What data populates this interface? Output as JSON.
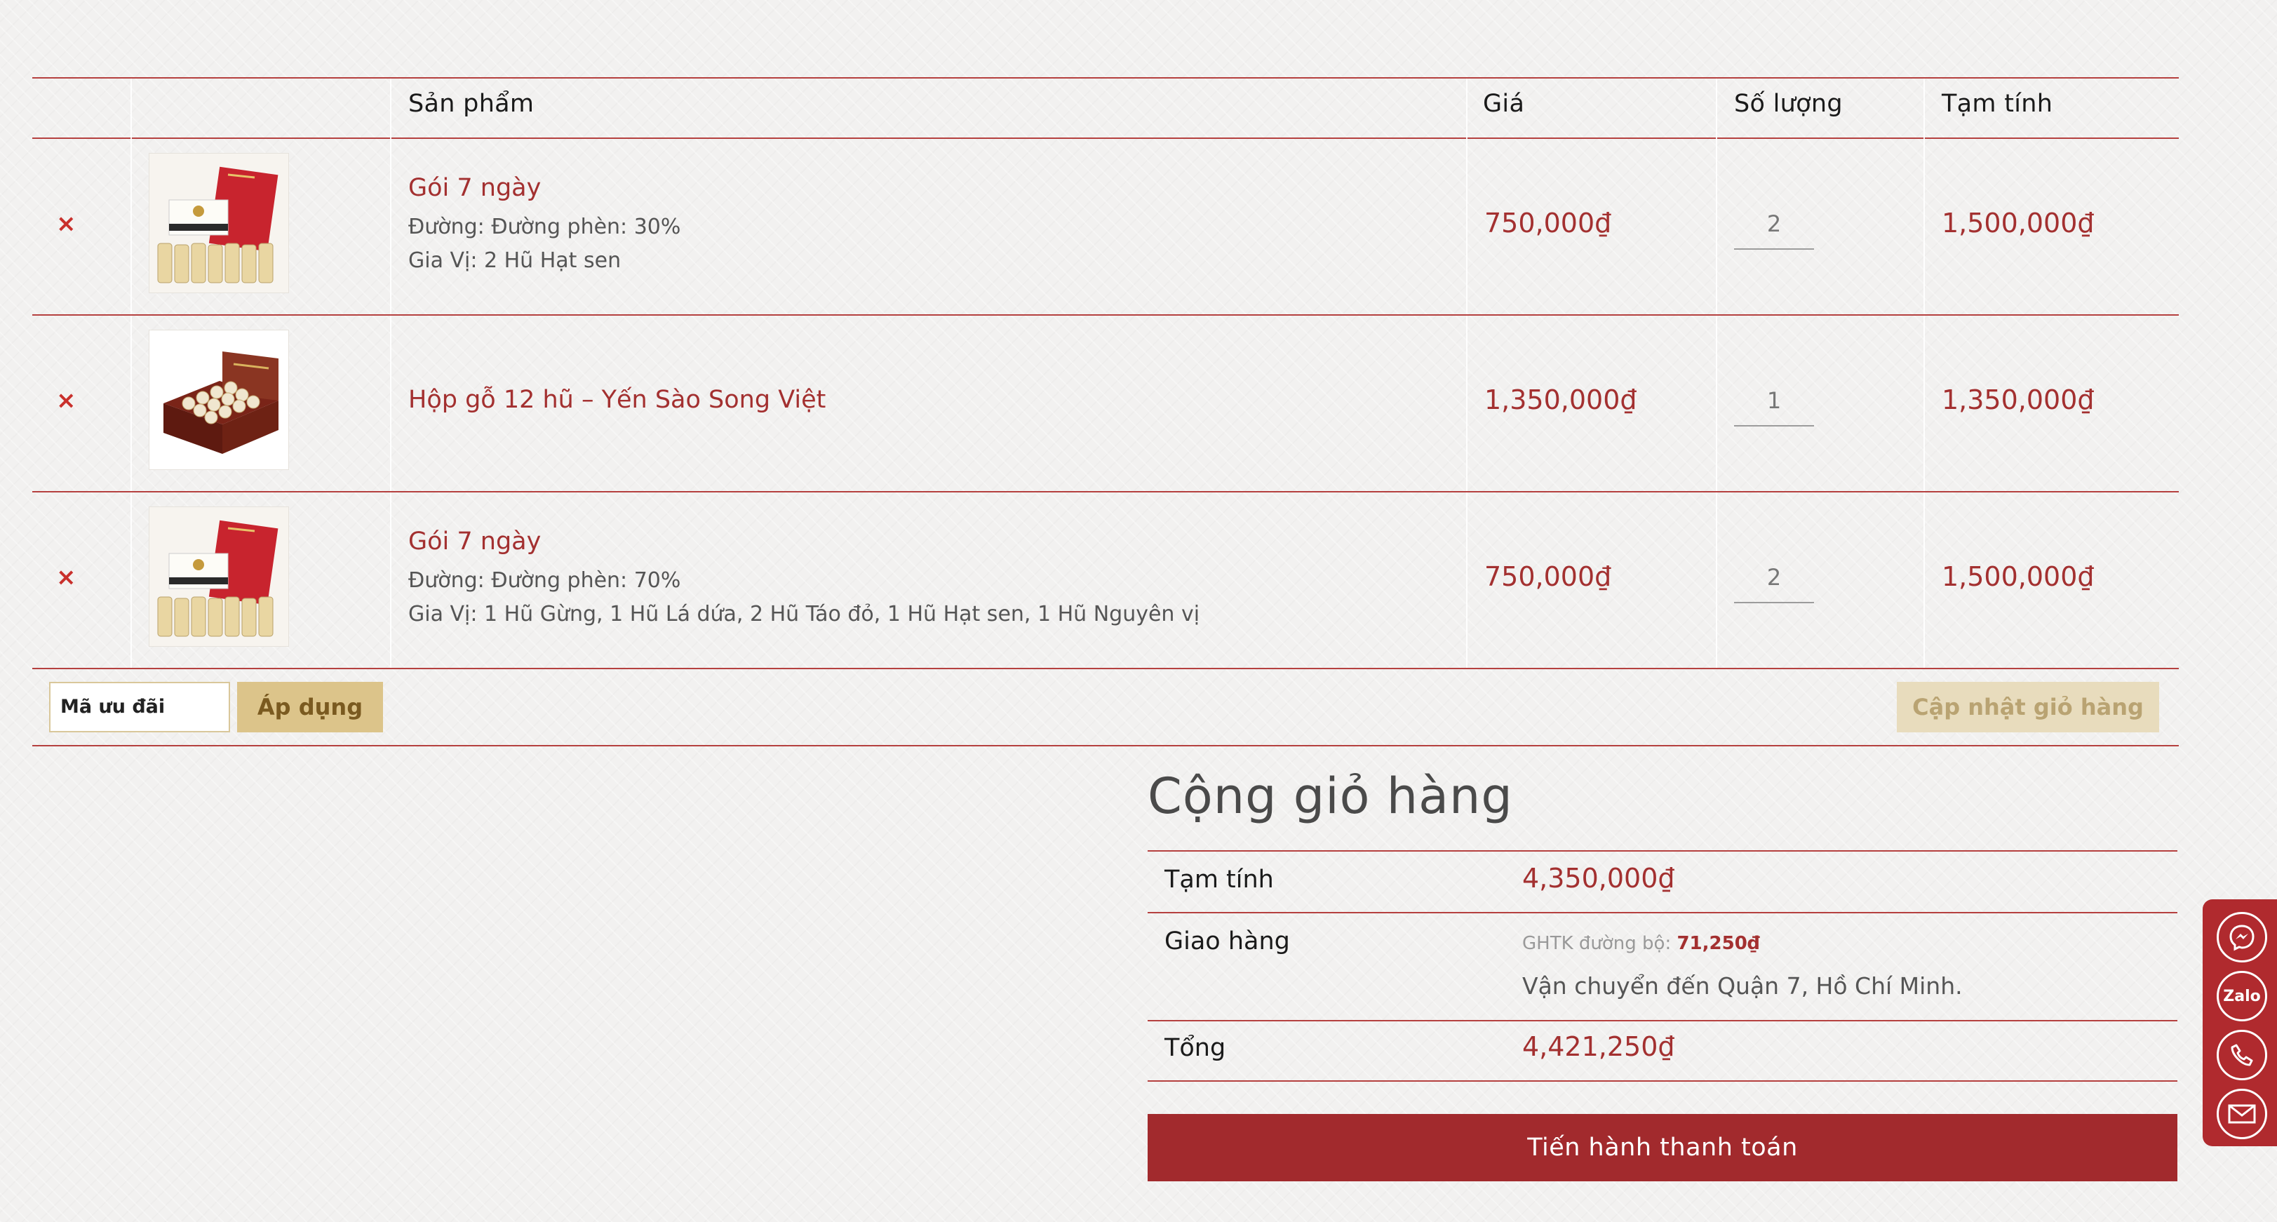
{
  "table": {
    "headers": {
      "product": "Sản phẩm",
      "price": "Giá",
      "quantity": "Số lượng",
      "subtotal": "Tạm tính"
    },
    "rows": [
      {
        "remove": "×",
        "name": "Gói 7 ngày",
        "meta1": "Đường: Đường phèn: 30%",
        "meta2": "Gia Vị: 2 Hũ Hạt sen",
        "price": "750,000₫",
        "qty": "2",
        "subtotal": "1,500,000₫"
      },
      {
        "remove": "×",
        "name": "Hộp gỗ 12 hũ – Yến Sào Song Việt",
        "price": "1,350,000₫",
        "qty": "1",
        "subtotal": "1,350,000₫"
      },
      {
        "remove": "×",
        "name": "Gói 7 ngày",
        "meta1": "Đường: Đường phèn: 70%",
        "meta2": "Gia Vị: 1 Hũ Gừng, 1 Hũ Lá dứa, 2 Hũ Táo đỏ, 1 Hũ Hạt sen, 1 Hũ Nguyên vị",
        "price": "750,000₫",
        "qty": "2",
        "subtotal": "1,500,000₫"
      }
    ]
  },
  "coupon": {
    "placeholder": "Mã ưu đãi",
    "apply_label": "Áp dụng"
  },
  "update_label": "Cập nhật giỏ hàng",
  "totals": {
    "title": "Cộng giỏ hàng",
    "subtotal_label": "Tạm tính",
    "subtotal_value": "4,350,000₫",
    "shipping_label": "Giao hàng",
    "shipping_method": "GHTK đường bộ:",
    "shipping_cost": "71,250₫",
    "shipping_dest": "Vận chuyển đến Quận 7, Hồ Chí Minh.",
    "total_label": "Tổng",
    "total_value": "4,421,250₫"
  },
  "checkout_label": "Tiến hành thanh toán",
  "contact": {
    "zalo_label": "Zalo",
    "accent": "#b02a2e"
  },
  "colors": {
    "accent_red": "#a33030",
    "line_red": "#b5403f",
    "gold": "#dcc48a"
  }
}
